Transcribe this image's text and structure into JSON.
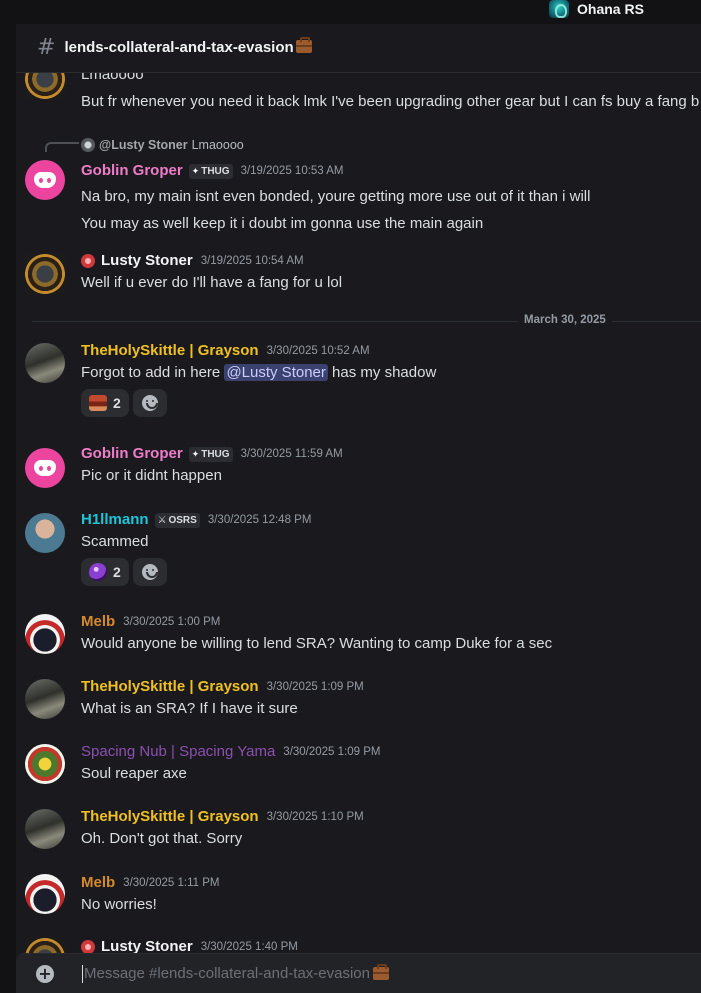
{
  "server": {
    "name": "Ohana RS"
  },
  "channel": {
    "name": "lends-collateral-and-tax-evasion"
  },
  "colors": {
    "goblin": "#ee7cc8",
    "skittle": "#f0c020",
    "h1llmann": "#1ec4d8",
    "melb": "#d58a2a",
    "spacing": "#8b4fb0",
    "white": "#f2f3f5"
  },
  "messages": {
    "lusty_cont": {
      "lines": [
        "Lmaoooo",
        "But fr whenever you need it back lmk I've been upgrading other gear but I can fs buy a fang b"
      ]
    },
    "goblin1": {
      "reply": {
        "name": "@Lusty Stoner",
        "text": "Lmaoooo"
      },
      "username": "Goblin Groper",
      "tag": "THUG",
      "timestamp": "3/19/2025 10:53 AM",
      "lines": [
        "Na bro, my main isnt even bonded, youre getting more use out of it than i will",
        "You may as well keep it i doubt im gonna use the main again"
      ]
    },
    "lusty1": {
      "username": "Lusty Stoner",
      "timestamp": "3/19/2025 10:54 AM",
      "text": "Well if u ever do I'll have a fang for u lol"
    },
    "divider": "March 30, 2025",
    "skittle1": {
      "username": "TheHolySkittle | Grayson",
      "timestamp": "3/30/2025 10:52 AM",
      "text_before": "Forgot to add in here ",
      "mention": "@Lusty Stoner",
      "text_after": " has my shadow",
      "reaction_count": "2"
    },
    "goblin2": {
      "username": "Goblin Groper",
      "tag": "THUG",
      "timestamp": "3/30/2025 11:59 AM",
      "text": "Pic or it didnt happen"
    },
    "h1ll": {
      "username": "H1llmann",
      "tag": "OSRS",
      "timestamp": "3/30/2025 12:48 PM",
      "text": "Scammed",
      "reaction_count": "2"
    },
    "melb1": {
      "username": "Melb",
      "timestamp": "3/30/2025 1:00 PM",
      "text": "Would anyone be willing to lend SRA? Wanting to camp Duke for a sec"
    },
    "skittle2": {
      "username": "TheHolySkittle | Grayson",
      "timestamp": "3/30/2025 1:09 PM",
      "text": "What is an SRA? If I have it sure"
    },
    "spacing": {
      "username": "Spacing Nub | Spacing Yama",
      "timestamp": "3/30/2025 1:09 PM",
      "text": "Soul reaper axe"
    },
    "skittle3": {
      "username": "TheHolySkittle | Grayson",
      "timestamp": "3/30/2025 1:10 PM",
      "text": "Oh. Don't got that. Sorry"
    },
    "melb2": {
      "username": "Melb",
      "timestamp": "3/30/2025 1:11 PM",
      "text": "No worries!"
    },
    "lusty2": {
      "username": "Lusty Stoner",
      "timestamp": "3/30/2025 1:40 PM"
    }
  },
  "composer": {
    "placeholder": "Message #lends-collateral-and-tax-evasion"
  },
  "icons": {
    "channel": "hash-icon",
    "add": "plus-icon",
    "add_reaction": "smile-icon",
    "emoji": "briefcase-emoji"
  }
}
